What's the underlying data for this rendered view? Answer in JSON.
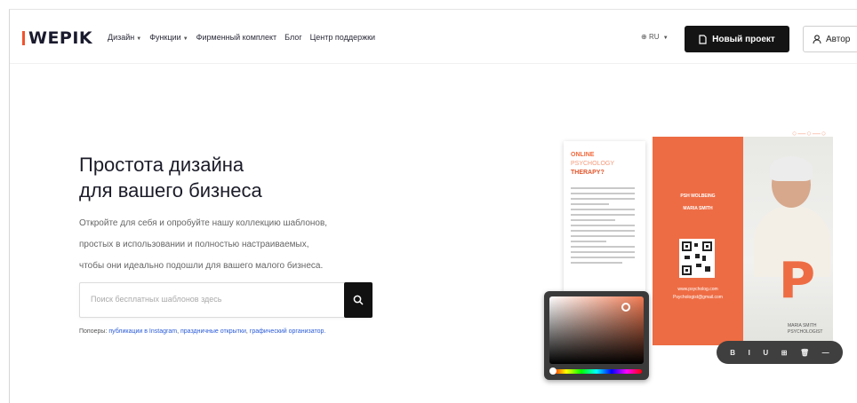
{
  "header": {
    "logo_text": "WEPIK",
    "menu": [
      {
        "label": "Дизайн",
        "has_caret": true
      },
      {
        "label": "Функции",
        "has_caret": true
      },
      {
        "label": "Фирменный комплект",
        "has_caret": false
      },
      {
        "label": "Блог",
        "has_caret": false
      },
      {
        "label": "Центр поддержки",
        "has_caret": false
      }
    ],
    "language": "RU",
    "new_project_label": "Новый проект",
    "login_label": "Автор"
  },
  "hero": {
    "headline_line1": "Простота дизайна",
    "headline_line2": "для вашего бизнеса",
    "desc_line1": "Откройте для себя и опробуйте нашу коллекцию шаблонов,",
    "desc_line2": "простых в использовании и полностью настраиваемых,",
    "desc_line3": "чтобы они идеально подошли для вашего малого бизнеса."
  },
  "search": {
    "placeholder": "Поиск бесплатных шаблонов здесь"
  },
  "popular": {
    "prefix": "Попоеры:",
    "links": [
      "публикации в Instagram",
      "праздничные открытки",
      "графический организатор."
    ]
  },
  "artwork": {
    "doc_title_1": "ONLINE",
    "doc_title_2": "PSYCHOLOGY",
    "doc_title_3": "THERAPY?",
    "orange_heading": "PSH WOLBEING",
    "orange_sub": "MARIA SMITH",
    "orange_site": "www.psycholog.com",
    "orange_email": "Psychologist@gmail.com",
    "big_letter": "P",
    "photo_name": "MARIA SMITH",
    "photo_role": "PSYCHOLOGIST",
    "toolbar_items": [
      "B",
      "I",
      "U",
      "⊞",
      "🗑",
      "—"
    ]
  },
  "colors": {
    "accent": "#ee6c44",
    "button_dark": "#141414",
    "link": "#2a5bd7"
  },
  "icons": {
    "globe": "globe-icon",
    "new_project": "document-icon",
    "login": "user-icon",
    "search": "search-icon"
  }
}
